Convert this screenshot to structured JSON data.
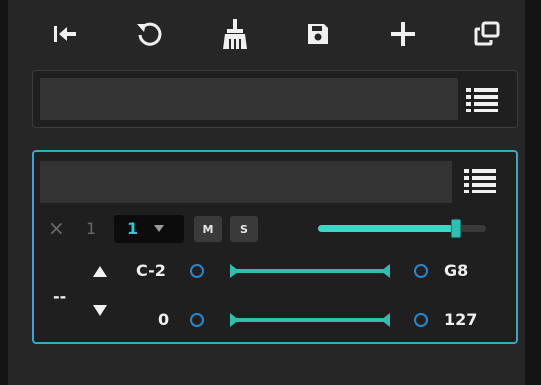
{
  "toolbar": {
    "buttons": [
      {
        "name": "go-start-icon"
      },
      {
        "name": "undo-icon"
      },
      {
        "name": "broom-icon"
      },
      {
        "name": "save-icon"
      },
      {
        "name": "plus-icon"
      },
      {
        "name": "duplicate-icon"
      }
    ]
  },
  "search": {
    "value": "",
    "placeholder": ""
  },
  "track": {
    "name_value": "",
    "name_placeholder": "",
    "remove_symbol": "×",
    "index": "1",
    "channel": "1",
    "mute_label": "M",
    "solo_label": "S",
    "volume_level": 0.82,
    "transpose": "--",
    "note_low": "C-2",
    "note_high": "G8",
    "velocity_low": "0",
    "velocity_high": "127",
    "note_range": [
      0,
      1
    ],
    "velocity_range": [
      0,
      1
    ]
  },
  "colors": {
    "accent": "#3cd6c6",
    "border_selected": "#3aa7c9",
    "ring": "#2c86c9",
    "channel_text": "#35c7d6"
  }
}
